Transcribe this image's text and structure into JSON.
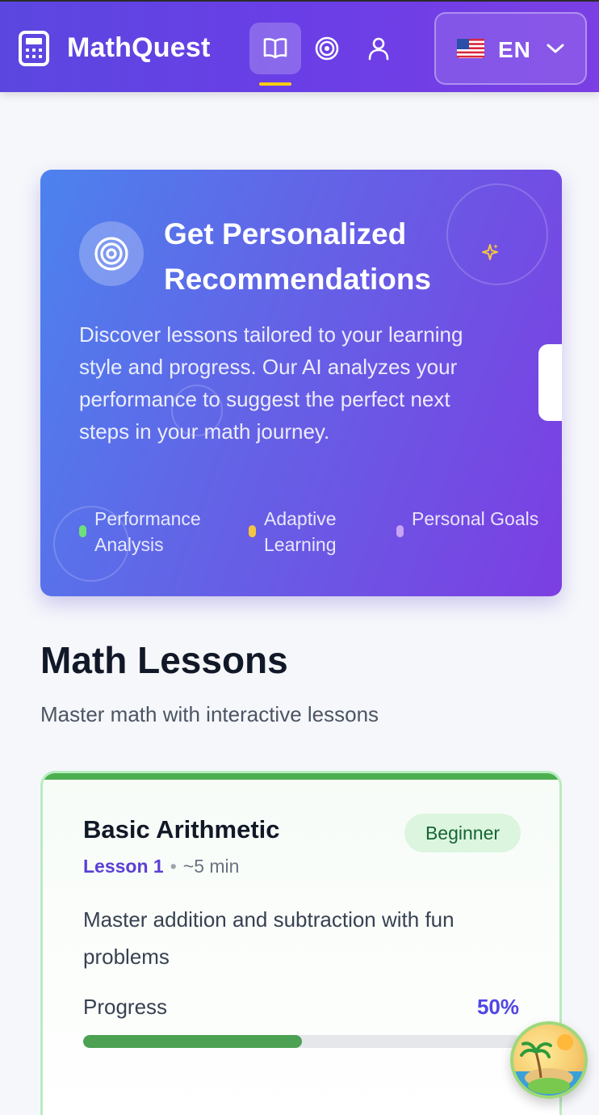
{
  "header": {
    "brand": "MathQuest",
    "nav_icons": [
      "book-icon",
      "target-icon",
      "user-icon"
    ],
    "active_nav": "book-icon",
    "language": {
      "flag": "🇺🇸",
      "code": "EN"
    }
  },
  "promo": {
    "title": "Get Personalized Recommendations",
    "description": "Discover lessons tailored to your learning style and progress. Our AI analyzes your performance to suggest the perfect next steps in your math journey.",
    "features": [
      {
        "label": "Performance Analysis",
        "color": "#6ee07a"
      },
      {
        "label": "Adaptive Learning",
        "color": "#f5c542"
      },
      {
        "label": "Personal Goals",
        "color": "#c9a3f5"
      }
    ]
  },
  "section": {
    "title": "Math Lessons",
    "subtitle": "Master math with interactive lessons"
  },
  "lesson": {
    "title": "Basic Arithmetic",
    "level": "Beginner",
    "number": "Lesson 1",
    "duration": "~5 min",
    "description": "Master addition and subtraction with fun problems",
    "progress_label": "Progress",
    "progress_text": "50%",
    "progress": 0.5
  },
  "colors": {
    "header_gradient_start": "#5b47e0",
    "header_gradient_end": "#7b3fe4",
    "accent_yellow": "#facc15",
    "progress_green": "#4ca153",
    "lesson_border": "#b9ecc0"
  }
}
